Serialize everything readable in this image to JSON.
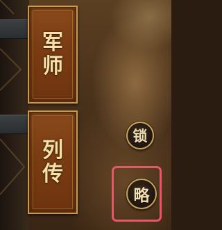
{
  "menu": {
    "items": [
      {
        "label_chars": [
          "军",
          "师"
        ]
      },
      {
        "label_chars": [
          "列",
          "传"
        ]
      }
    ]
  },
  "buttons": {
    "lock_label": "锁",
    "strategy_label": "略"
  },
  "colors": {
    "card_fill": "#7a3c12",
    "card_border": "#c79a4e",
    "text_gold": "#f6e2a8",
    "highlight": "#e8566a"
  }
}
